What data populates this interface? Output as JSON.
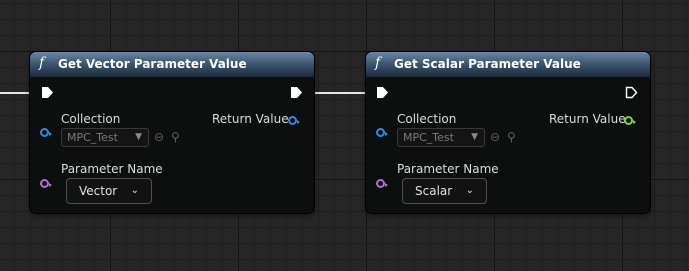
{
  "nodes": [
    {
      "title": "Get Vector Parameter Value",
      "icon": "f",
      "collection_label": "Collection",
      "collection_value": "MPC_Test",
      "return_label": "Return Value",
      "param_label": "Parameter Name",
      "param_value": "Vector",
      "return_pin_color": "#2a8de8"
    },
    {
      "title": "Get Scalar Parameter Value",
      "icon": "f",
      "collection_label": "Collection",
      "collection_value": "MPC_Test",
      "return_label": "Return Value",
      "param_label": "Parameter Name",
      "param_value": "Scalar",
      "return_pin_color": "#7fd83a"
    }
  ],
  "colors": {
    "header": "#3d5873",
    "object_pin": "#2a8de8",
    "name_pin": "#b070e0",
    "vector_pin": "#2a8de8",
    "float_pin": "#7fd83a",
    "wire": "#e6e6e6"
  }
}
